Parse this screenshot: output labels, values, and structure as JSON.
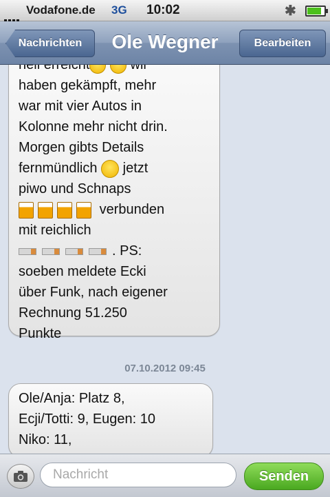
{
  "status_bar": {
    "carrier": "Vodafone.de",
    "network": "3G",
    "time": "10:02",
    "bluetooth_icon": "bluetooth-icon",
    "battery_icon": "battery-icon",
    "battery_level": 0.75
  },
  "nav": {
    "back_label": "Nachrichten",
    "title": "Ole Wegner",
    "edit_label": "Bearbeiten"
  },
  "messages": [
    {
      "direction": "incoming",
      "lines": [
        "heil erreicht",
        "haben gekämpft, mehr",
        "war mit vier Autos in",
        "Kolonne mehr nicht drin.",
        "Morgen gibts Details",
        "fernmündlich",
        "piwo und Schnaps",
        "verbunden",
        "mit reichlich",
        ". PS:",
        "soeben meldete Ecki",
        "über Funk, nach eigener",
        "Rechnung 51.250",
        "Punkte"
      ],
      "inline_words": {
        "wir": "wir",
        "jetzt": "jetzt"
      }
    },
    {
      "direction": "incoming",
      "timestamp": "07.10.2012 09:45",
      "lines": [
        "Ole/Anja: Platz 8,",
        "Ecji/Totti: 9, Eugen: 10",
        "Niko: 11,"
      ]
    }
  ],
  "input": {
    "placeholder": "Nachricht",
    "send_label": "Senden",
    "camera_icon": "camera-icon"
  },
  "colors": {
    "send_green": "#5cbf2a",
    "nav_blue": "#7d92b1",
    "background": "#dbe2ed"
  }
}
